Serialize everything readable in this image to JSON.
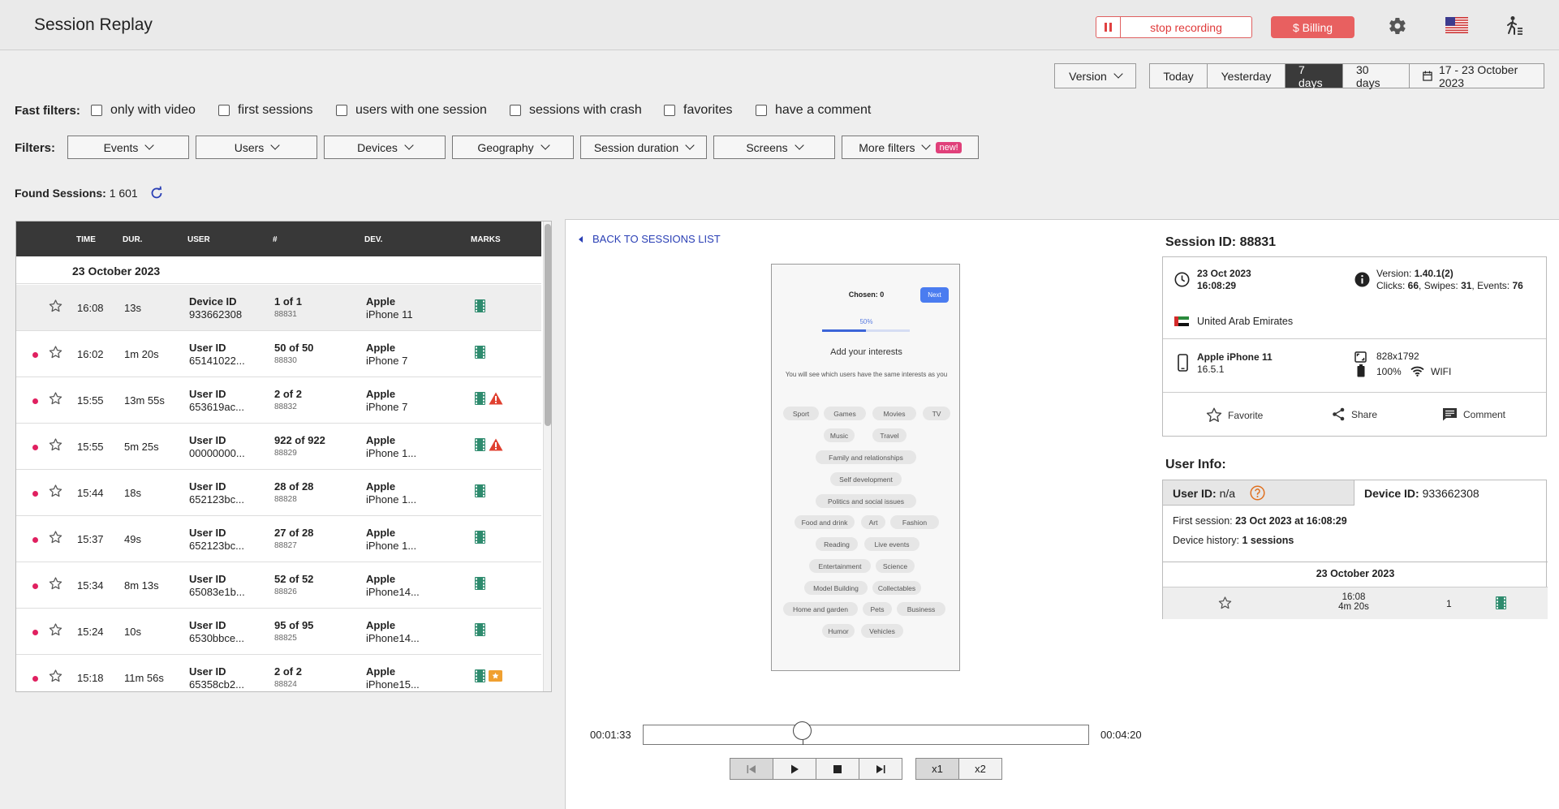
{
  "header": {
    "title": "Session Replay",
    "stop_recording": "stop recording",
    "billing": "$ Billing"
  },
  "version_select": "Version",
  "ranges": [
    "Today",
    "Yesterday",
    "7 days",
    "30 days",
    "17 - 23 October 2023"
  ],
  "active_range": "7 days",
  "fast_filters": {
    "label": "Fast filters:",
    "items": [
      "only with video",
      "first sessions",
      "users with one session",
      "sessions with crash",
      "favorites",
      "have a comment"
    ]
  },
  "filters": {
    "label": "Filters:",
    "items": [
      "Events",
      "Users",
      "Devices",
      "Geography",
      "Session duration",
      "Screens",
      "More filters"
    ],
    "new_badge": "new!"
  },
  "found": {
    "label": "Found Sessions:",
    "count": "1 601"
  },
  "table": {
    "headers": [
      "TIME",
      "DUR.",
      "USER",
      "#",
      "DEV.",
      "MARKS"
    ],
    "date_group": "23 October 2023",
    "rows": [
      {
        "time": "16:08",
        "dur": "13s",
        "user_label": "Device ID",
        "user_id": "933662308",
        "num": "1 of 1",
        "sid": "88831",
        "dev1": "Apple",
        "dev2": "iPhone 11",
        "marks": [
          "video"
        ],
        "dot": false
      },
      {
        "time": "16:02",
        "dur": "1m 20s",
        "user_label": "User ID",
        "user_id": "65141022...",
        "num": "50 of 50",
        "sid": "88830",
        "dev1": "Apple",
        "dev2": "iPhone 7",
        "marks": [
          "video"
        ],
        "dot": true
      },
      {
        "time": "15:55",
        "dur": "13m 55s",
        "user_label": "User ID",
        "user_id": "653619ac...",
        "num": "2 of 2",
        "sid": "88832",
        "dev1": "Apple",
        "dev2": "iPhone 7",
        "marks": [
          "video",
          "crash"
        ],
        "dot": true
      },
      {
        "time": "15:55",
        "dur": "5m 25s",
        "user_label": "User ID",
        "user_id": "00000000...",
        "num": "922 of 922",
        "sid": "88829",
        "dev1": "Apple",
        "dev2": "iPhone 1...",
        "marks": [
          "video",
          "crash"
        ],
        "dot": true
      },
      {
        "time": "15:44",
        "dur": "18s",
        "user_label": "User ID",
        "user_id": "652123bc...",
        "num": "28 of 28",
        "sid": "88828",
        "dev1": "Apple",
        "dev2": "iPhone 1...",
        "marks": [
          "video"
        ],
        "dot": true
      },
      {
        "time": "15:37",
        "dur": "49s",
        "user_label": "User ID",
        "user_id": "652123bc...",
        "num": "27 of 28",
        "sid": "88827",
        "dev1": "Apple",
        "dev2": "iPhone 1...",
        "marks": [
          "video"
        ],
        "dot": true
      },
      {
        "time": "15:34",
        "dur": "8m 13s",
        "user_label": "User ID",
        "user_id": "65083e1b...",
        "num": "52 of 52",
        "sid": "88826",
        "dev1": "Apple",
        "dev2": "iPhone14...",
        "marks": [
          "video"
        ],
        "dot": true
      },
      {
        "time": "15:24",
        "dur": "10s",
        "user_label": "User ID",
        "user_id": "6530bbce...",
        "num": "95 of 95",
        "sid": "88825",
        "dev1": "Apple",
        "dev2": "iPhone14...",
        "marks": [
          "video"
        ],
        "dot": true
      },
      {
        "time": "15:18",
        "dur": "11m 56s",
        "user_label": "User ID",
        "user_id": "65358cb2...",
        "num": "2 of 2",
        "sid": "88824",
        "dev1": "Apple",
        "dev2": "iPhone15...",
        "marks": [
          "video",
          "event"
        ],
        "dot": true
      }
    ]
  },
  "player": {
    "back": "BACK TO SESSIONS LIST",
    "current_time": "00:01:33",
    "total_time": "00:04:20",
    "progress": 0.358,
    "speeds": [
      "x1",
      "x2"
    ],
    "active_speed": "x1"
  },
  "phone": {
    "chosen": "Chosen: 0",
    "next": "Next",
    "progress_text": "50%",
    "progress": 0.5,
    "heading": "Add your interests",
    "subtext": "You will see which users have the same interests as you",
    "chips": [
      "Sport",
      "Games",
      "Movies",
      "TV",
      "Music",
      "Travel",
      "Family and relationships",
      "Self development",
      "Politics and social issues",
      "Food and drink",
      "Art",
      "Fashion",
      "Reading",
      "Live events",
      "Entertainment",
      "Science",
      "Model Building",
      "Collectables",
      "Home and garden",
      "Pets",
      "Business",
      "Humor",
      "Vehicles"
    ]
  },
  "session": {
    "title": "Session ID: 88831",
    "date": "23 Oct 2023",
    "time": "16:08:29",
    "version_label": "Version: ",
    "version": "1.40.1(2)",
    "clicks_label": "Clicks: ",
    "clicks": "66",
    "swipes_label": ", Swipes: ",
    "swipes": "31",
    "events_label": ", Events: ",
    "events": "76",
    "country": "United Arab Emirates",
    "device": "Apple iPhone 11",
    "os": "16.5.1",
    "resolution": "828x1792",
    "battery": "100%",
    "network": "WIFI",
    "actions": [
      "Favorite",
      "Share",
      "Comment"
    ]
  },
  "user_info": {
    "title": "User Info:",
    "user_id_label": "User ID:",
    "user_id": "n/a",
    "device_id_label": "Device ID:",
    "device_id": "933662308",
    "first_session_label": "First session: ",
    "first_session": "23 Oct 2023 at 16:08:29",
    "device_history_label": "Device history: ",
    "device_history": "1 sessions",
    "date_group": "23 October 2023",
    "row": {
      "time": "16:08",
      "dur": "4m 20s",
      "count": "1"
    }
  },
  "colors": {
    "accent_red": "#e86060",
    "dark_header": "#383838",
    "link_blue": "#2a3fb5",
    "dot_pink": "#e02060",
    "video_green": "#2e8b6e",
    "crash_red": "#e04030",
    "event_orange": "#f0a030"
  }
}
